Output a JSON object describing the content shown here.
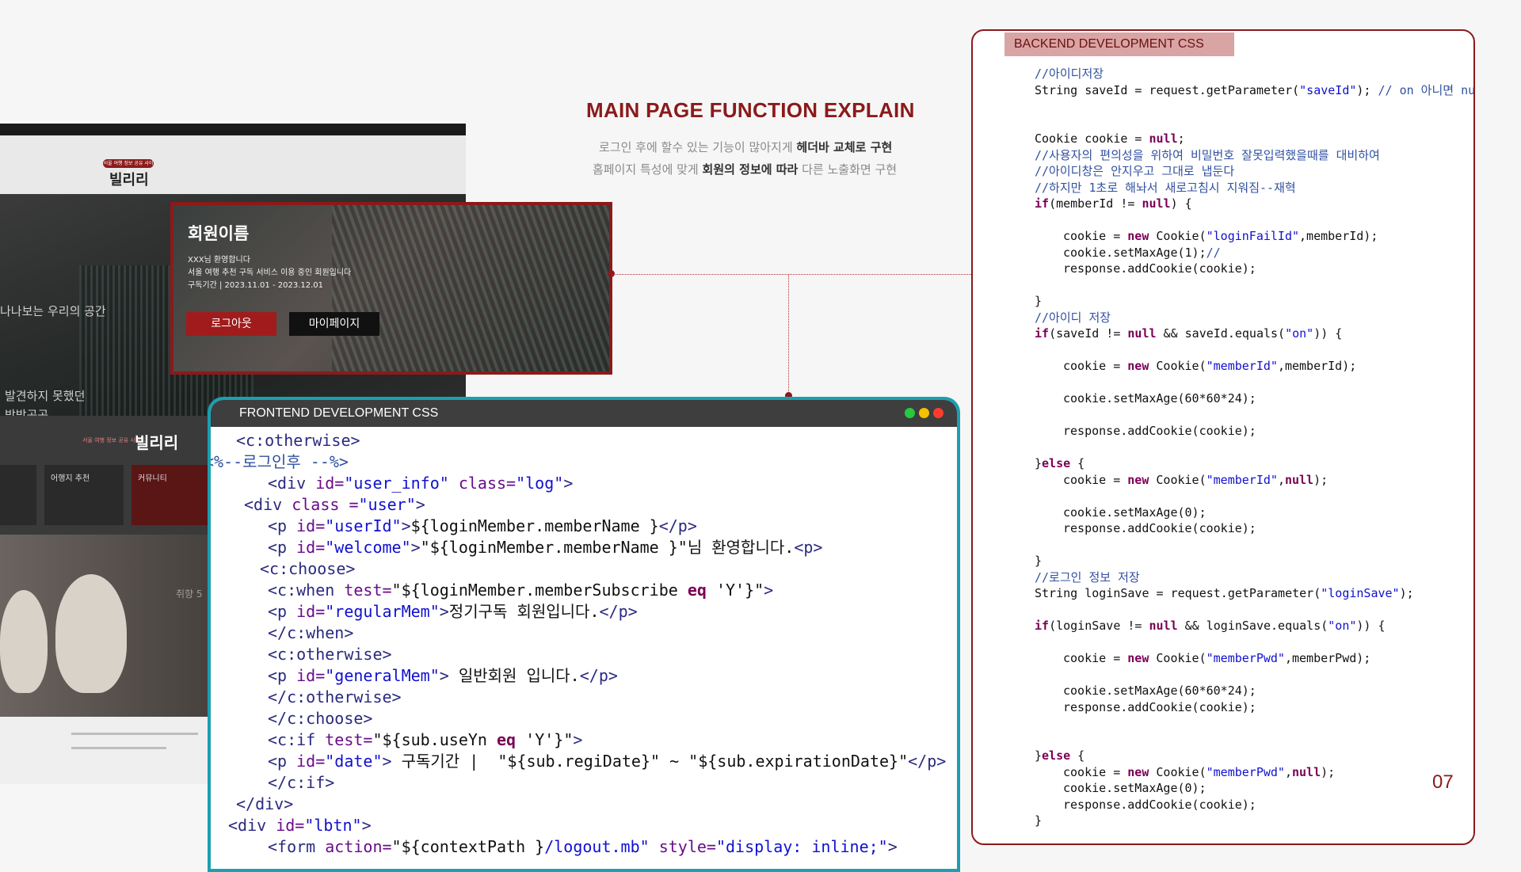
{
  "colors": {
    "accent": "#8b1a1a",
    "frontend_border": "#1aa0b0",
    "titlebar": "#3e3e3e"
  },
  "title": "MAIN PAGE FUNCTION EXPLAIN",
  "description": {
    "line1": [
      {
        "text": "로그인 후에 할수 있는 기능이 많아지게 ",
        "bold": false
      },
      {
        "text": "헤더바 교체로 구현",
        "bold": true
      }
    ],
    "line2": [
      {
        "text": "홈페이지 특성에 맞게 ",
        "bold": false
      },
      {
        "text": "회원의 정보에 따라",
        "bold": true
      },
      {
        "text": " 다른 노출화면 구현",
        "bold": false
      }
    ]
  },
  "site_mock": {
    "pill": "서울 여행 정보 공유 사이트",
    "logo": "빌리리",
    "hero_lines": [
      "발견하지 못했던",
      "방방곡곡",
      "나나보는 우리의 공간"
    ],
    "sec2_pill": "서울 여행 정보 공유 사이트",
    "sec2_title": "빌리리",
    "cards": [
      "어행지 추천",
      "커뮤니티"
    ],
    "sec3_label": "취향 5"
  },
  "popup": {
    "name": "회원이름",
    "lines": [
      "XXX님 환영합니다",
      "서울 여행 추천 구독 서비스 이용 중인 회원입니다",
      "구독기간 | 2023.11.01 - 2023.12.01"
    ],
    "logout_label": "로그아웃",
    "mypage_label": "마이페이지"
  },
  "frontend": {
    "title": "FRONTEND DEVELOPMENT  CSS",
    "traffic_colors": [
      "#27c93f",
      "#f5c000",
      "#ff3b30"
    ],
    "lines": [
      {
        "indent": 3,
        "tokens": [
          {
            "c": "tag",
            "t": "<c:otherwise>"
          }
        ]
      },
      {
        "indent": -1,
        "tokens": [
          {
            "c": "comment",
            "t": "<%--로그인후 --%>"
          }
        ]
      },
      {
        "indent": 7,
        "tokens": [
          {
            "c": "tag",
            "t": "<div "
          },
          {
            "c": "attr",
            "t": "id="
          },
          {
            "c": "val",
            "t": "\"user_info\""
          },
          {
            "c": "attr",
            "t": " class="
          },
          {
            "c": "val",
            "t": "\"log\""
          },
          {
            "c": "tag",
            "t": ">"
          }
        ]
      },
      {
        "indent": 4,
        "tokens": [
          {
            "c": "tag",
            "t": "<div "
          },
          {
            "c": "attr",
            "t": "class ="
          },
          {
            "c": "val",
            "t": "\"user\""
          },
          {
            "c": "tag",
            "t": ">"
          }
        ]
      },
      {
        "indent": 7,
        "tokens": [
          {
            "c": "tag",
            "t": "<p "
          },
          {
            "c": "attr",
            "t": "id="
          },
          {
            "c": "val",
            "t": "\"userId\""
          },
          {
            "c": "tag",
            "t": ">"
          },
          {
            "c": "plain",
            "t": "${loginMember.memberName }"
          },
          {
            "c": "tag",
            "t": "</p>"
          }
        ]
      },
      {
        "indent": 7,
        "tokens": [
          {
            "c": "tag",
            "t": "<p "
          },
          {
            "c": "attr",
            "t": "id="
          },
          {
            "c": "val",
            "t": "\"welcome\""
          },
          {
            "c": "tag",
            "t": ">"
          },
          {
            "c": "plain",
            "t": "\"${loginMember.memberName }\"님 환영합니다."
          },
          {
            "c": "tag",
            "t": "<p>"
          }
        ]
      },
      {
        "indent": 6,
        "tokens": [
          {
            "c": "tag",
            "t": "<c:choose>"
          }
        ]
      },
      {
        "indent": 7,
        "tokens": [
          {
            "c": "tag",
            "t": "<c:when "
          },
          {
            "c": "attr",
            "t": "test="
          },
          {
            "c": "plain",
            "t": "\"${loginMember.memberSubscribe "
          },
          {
            "c": "kw",
            "t": "eq"
          },
          {
            "c": "plain",
            "t": " 'Y'}\""
          },
          {
            "c": "tag",
            "t": ">"
          }
        ]
      },
      {
        "indent": 7,
        "tokens": [
          {
            "c": "tag",
            "t": "<p "
          },
          {
            "c": "attr",
            "t": "id="
          },
          {
            "c": "val",
            "t": "\"regularMem\""
          },
          {
            "c": "tag",
            "t": ">"
          },
          {
            "c": "plain",
            "t": "정기구독 회원입니다."
          },
          {
            "c": "tag",
            "t": "</p>"
          }
        ]
      },
      {
        "indent": 7,
        "tokens": [
          {
            "c": "tag",
            "t": "</c:when>"
          }
        ]
      },
      {
        "indent": 7,
        "tokens": [
          {
            "c": "tag",
            "t": "<c:otherwise>"
          }
        ]
      },
      {
        "indent": 7,
        "tokens": [
          {
            "c": "tag",
            "t": "<p "
          },
          {
            "c": "attr",
            "t": "id="
          },
          {
            "c": "val",
            "t": "\"generalMem\""
          },
          {
            "c": "tag",
            "t": ">"
          },
          {
            "c": "plain",
            "t": " 일반회원 입니다."
          },
          {
            "c": "tag",
            "t": "</p>"
          }
        ]
      },
      {
        "indent": 7,
        "tokens": [
          {
            "c": "tag",
            "t": "</c:otherwise>"
          }
        ]
      },
      {
        "indent": 7,
        "tokens": [
          {
            "c": "tag",
            "t": "</c:choose>"
          }
        ]
      },
      {
        "indent": 7,
        "tokens": [
          {
            "c": "tag",
            "t": "<c:if "
          },
          {
            "c": "attr",
            "t": "test="
          },
          {
            "c": "plain",
            "t": "\"${sub.useYn "
          },
          {
            "c": "kw",
            "t": "eq"
          },
          {
            "c": "plain",
            "t": " 'Y'}\""
          },
          {
            "c": "tag",
            "t": ">"
          }
        ]
      },
      {
        "indent": 7,
        "tokens": [
          {
            "c": "tag",
            "t": "<p "
          },
          {
            "c": "attr",
            "t": "id="
          },
          {
            "c": "val",
            "t": "\"date\""
          },
          {
            "c": "tag",
            "t": ">"
          },
          {
            "c": "plain",
            "t": " 구독기간 |  \"${sub.regiDate}\" ~ \"${sub.expirationDate}\""
          },
          {
            "c": "tag",
            "t": "</p>"
          }
        ]
      },
      {
        "indent": 7,
        "tokens": [
          {
            "c": "tag",
            "t": "</c:if>"
          }
        ]
      },
      {
        "indent": 3,
        "tokens": [
          {
            "c": "tag",
            "t": "</div>"
          }
        ]
      },
      {
        "indent": 2,
        "tokens": [
          {
            "c": "tag",
            "t": "<div "
          },
          {
            "c": "attr",
            "t": "id="
          },
          {
            "c": "val",
            "t": "\"lbtn\""
          },
          {
            "c": "tag",
            "t": ">"
          }
        ]
      },
      {
        "indent": 7,
        "tokens": [
          {
            "c": "tag",
            "t": "<form "
          },
          {
            "c": "attr",
            "t": "action="
          },
          {
            "c": "plain",
            "t": "\"${contextPath }"
          },
          {
            "c": "val",
            "t": "/logout.mb\""
          },
          {
            "c": "attr",
            "t": " style="
          },
          {
            "c": "val",
            "t": "\"display: inline;\""
          },
          {
            "c": "tag",
            "t": ">"
          }
        ]
      }
    ]
  },
  "backend": {
    "title": "BACKEND DEVELOPMENT  CSS",
    "lines": [
      {
        "indent": 0,
        "tokens": [
          {
            "c": "comment",
            "t": "//아이디저장"
          }
        ]
      },
      {
        "indent": 0,
        "tokens": [
          {
            "c": "plain",
            "t": "String saveId = request.getParameter("
          },
          {
            "c": "str",
            "t": "\"saveId\""
          },
          {
            "c": "plain",
            "t": "); "
          },
          {
            "c": "comment",
            "t": "// on 아니면 null"
          }
        ]
      },
      {
        "indent": 0,
        "tokens": []
      },
      {
        "indent": 0,
        "tokens": []
      },
      {
        "indent": 0,
        "tokens": [
          {
            "c": "plain",
            "t": "Cookie cookie = "
          },
          {
            "c": "kw",
            "t": "null"
          },
          {
            "c": "plain",
            "t": ";"
          }
        ]
      },
      {
        "indent": 0,
        "tokens": [
          {
            "c": "comment",
            "t": "//사용자의 편의성을 위하여 비밀번호 잘못입력했을때를 대비하여"
          }
        ]
      },
      {
        "indent": 0,
        "tokens": [
          {
            "c": "comment",
            "t": "//아이디창은 안지우고 그대로 냅둔다"
          }
        ]
      },
      {
        "indent": 0,
        "tokens": [
          {
            "c": "comment",
            "t": "//하지만 1초로 해놔서 새로고침시 지워짐--재혁"
          }
        ]
      },
      {
        "indent": 0,
        "tokens": [
          {
            "c": "kw",
            "t": "if"
          },
          {
            "c": "plain",
            "t": "(memberId != "
          },
          {
            "c": "kw",
            "t": "null"
          },
          {
            "c": "plain",
            "t": ") {"
          }
        ]
      },
      {
        "indent": 0,
        "tokens": []
      },
      {
        "indent": 4,
        "tokens": [
          {
            "c": "plain",
            "t": "cookie = "
          },
          {
            "c": "kw",
            "t": "new"
          },
          {
            "c": "plain",
            "t": " Cookie("
          },
          {
            "c": "str",
            "t": "\"loginFailId\""
          },
          {
            "c": "plain",
            "t": ",memberId);"
          }
        ]
      },
      {
        "indent": 4,
        "tokens": [
          {
            "c": "plain",
            "t": "cookie.setMaxAge(1);"
          },
          {
            "c": "comment",
            "t": "//"
          }
        ]
      },
      {
        "indent": 4,
        "tokens": [
          {
            "c": "plain",
            "t": "response.addCookie(cookie);"
          }
        ]
      },
      {
        "indent": 0,
        "tokens": []
      },
      {
        "indent": 0,
        "tokens": [
          {
            "c": "plain",
            "t": "}"
          }
        ]
      },
      {
        "indent": 0,
        "tokens": [
          {
            "c": "comment",
            "t": "//아이디 저장"
          }
        ]
      },
      {
        "indent": 0,
        "tokens": [
          {
            "c": "kw",
            "t": "if"
          },
          {
            "c": "plain",
            "t": "(saveId != "
          },
          {
            "c": "kw",
            "t": "null"
          },
          {
            "c": "plain",
            "t": " && saveId.equals("
          },
          {
            "c": "str",
            "t": "\"on\""
          },
          {
            "c": "plain",
            "t": ")) {"
          }
        ]
      },
      {
        "indent": 0,
        "tokens": []
      },
      {
        "indent": 4,
        "tokens": [
          {
            "c": "plain",
            "t": "cookie = "
          },
          {
            "c": "kw",
            "t": "new"
          },
          {
            "c": "plain",
            "t": " Cookie("
          },
          {
            "c": "str",
            "t": "\"memberId\""
          },
          {
            "c": "plain",
            "t": ",memberId);"
          }
        ]
      },
      {
        "indent": 0,
        "tokens": []
      },
      {
        "indent": 4,
        "tokens": [
          {
            "c": "plain",
            "t": "cookie.setMaxAge(60*60*24);"
          }
        ]
      },
      {
        "indent": 0,
        "tokens": []
      },
      {
        "indent": 4,
        "tokens": [
          {
            "c": "plain",
            "t": "response.addCookie(cookie);"
          }
        ]
      },
      {
        "indent": 0,
        "tokens": []
      },
      {
        "indent": 0,
        "tokens": [
          {
            "c": "plain",
            "t": "}"
          },
          {
            "c": "kw",
            "t": "else"
          },
          {
            "c": "plain",
            "t": " {"
          }
        ]
      },
      {
        "indent": 4,
        "tokens": [
          {
            "c": "plain",
            "t": "cookie = "
          },
          {
            "c": "kw",
            "t": "new"
          },
          {
            "c": "plain",
            "t": " Cookie("
          },
          {
            "c": "str",
            "t": "\"memberId\""
          },
          {
            "c": "plain",
            "t": ","
          },
          {
            "c": "kw",
            "t": "null"
          },
          {
            "c": "plain",
            "t": ");"
          }
        ]
      },
      {
        "indent": 0,
        "tokens": []
      },
      {
        "indent": 4,
        "tokens": [
          {
            "c": "plain",
            "t": "cookie.setMaxAge(0);"
          }
        ]
      },
      {
        "indent": 4,
        "tokens": [
          {
            "c": "plain",
            "t": "response.addCookie(cookie);"
          }
        ]
      },
      {
        "indent": 0,
        "tokens": []
      },
      {
        "indent": 0,
        "tokens": [
          {
            "c": "plain",
            "t": "}"
          }
        ]
      },
      {
        "indent": 0,
        "tokens": [
          {
            "c": "comment",
            "t": "//로그인 정보 저장"
          }
        ]
      },
      {
        "indent": 0,
        "tokens": [
          {
            "c": "plain",
            "t": "String loginSave = request.getParameter("
          },
          {
            "c": "str",
            "t": "\"loginSave\""
          },
          {
            "c": "plain",
            "t": ");"
          }
        ]
      },
      {
        "indent": 0,
        "tokens": []
      },
      {
        "indent": 0,
        "tokens": [
          {
            "c": "kw",
            "t": "if"
          },
          {
            "c": "plain",
            "t": "(loginSave != "
          },
          {
            "c": "kw",
            "t": "null"
          },
          {
            "c": "plain",
            "t": " && loginSave.equals("
          },
          {
            "c": "str",
            "t": "\"on\""
          },
          {
            "c": "plain",
            "t": ")) {"
          }
        ]
      },
      {
        "indent": 0,
        "tokens": []
      },
      {
        "indent": 4,
        "tokens": [
          {
            "c": "plain",
            "t": "cookie = "
          },
          {
            "c": "kw",
            "t": "new"
          },
          {
            "c": "plain",
            "t": " Cookie("
          },
          {
            "c": "str",
            "t": "\"memberPwd\""
          },
          {
            "c": "plain",
            "t": ",memberPwd);"
          }
        ]
      },
      {
        "indent": 0,
        "tokens": []
      },
      {
        "indent": 4,
        "tokens": [
          {
            "c": "plain",
            "t": "cookie.setMaxAge(60*60*24);"
          }
        ]
      },
      {
        "indent": 4,
        "tokens": [
          {
            "c": "plain",
            "t": "response.addCookie(cookie);"
          }
        ]
      },
      {
        "indent": 0,
        "tokens": []
      },
      {
        "indent": 0,
        "tokens": []
      },
      {
        "indent": 0,
        "tokens": [
          {
            "c": "plain",
            "t": "}"
          },
          {
            "c": "kw",
            "t": "else"
          },
          {
            "c": "plain",
            "t": " {"
          }
        ]
      },
      {
        "indent": 4,
        "tokens": [
          {
            "c": "plain",
            "t": "cookie = "
          },
          {
            "c": "kw",
            "t": "new"
          },
          {
            "c": "plain",
            "t": " Cookie("
          },
          {
            "c": "str",
            "t": "\"memberPwd\""
          },
          {
            "c": "plain",
            "t": ","
          },
          {
            "c": "kw",
            "t": "null"
          },
          {
            "c": "plain",
            "t": ");"
          }
        ]
      },
      {
        "indent": 4,
        "tokens": [
          {
            "c": "plain",
            "t": "cookie.setMaxAge(0);"
          }
        ]
      },
      {
        "indent": 4,
        "tokens": [
          {
            "c": "plain",
            "t": "response.addCookie(cookie);"
          }
        ]
      },
      {
        "indent": 0,
        "tokens": [
          {
            "c": "plain",
            "t": "}"
          }
        ]
      }
    ]
  },
  "page_number": "07"
}
